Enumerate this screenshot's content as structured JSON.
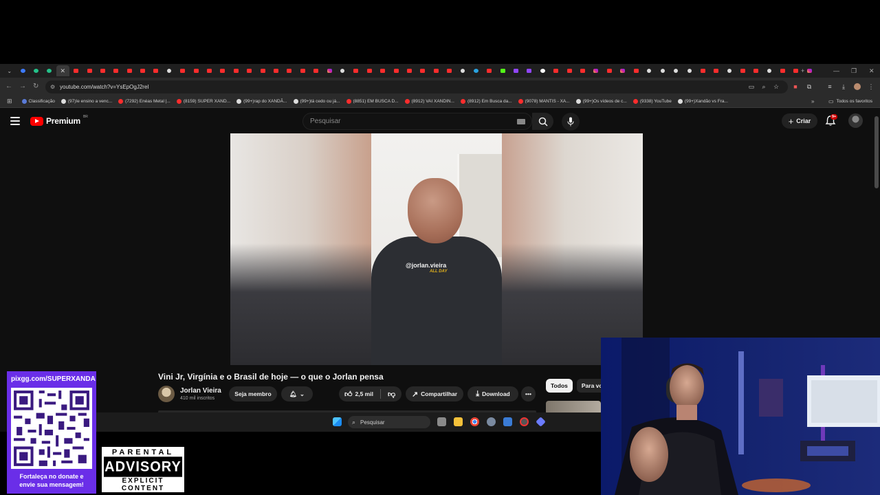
{
  "browser": {
    "url": "youtube.com/watch?v=YsEpOgJ2reI",
    "bookmarks": [
      {
        "label": "Classificação",
        "color": "#5a7bd8"
      },
      {
        "label": "(97)Ie ensino a venc...",
        "color": "#dddddd"
      },
      {
        "label": "(7292) Enéas Metal |...",
        "color": "#ff2d2d"
      },
      {
        "label": "(8159) SUPER XAND...",
        "color": "#ff2d2d"
      },
      {
        "label": "(99+)rap do XANDÃ...",
        "color": "#dddddd"
      },
      {
        "label": "(99+)tá cedo ou já...",
        "color": "#dddddd"
      },
      {
        "label": "(8851) EM BUSCA D...",
        "color": "#ff2d2d"
      },
      {
        "label": "(8912) VAI XANDIN...",
        "color": "#ff2d2d"
      },
      {
        "label": "(8912) Em Busca da...",
        "color": "#ff2d2d"
      },
      {
        "label": "(9078) MANTIS - XA...",
        "color": "#ff2d2d"
      },
      {
        "label": "(99+)Os vídeos de c...",
        "color": "#dddddd"
      },
      {
        "label": "(9338) YouTube",
        "color": "#ff2d2d"
      },
      {
        "label": "(99+)Xandão vs Fra...",
        "color": "#dddddd"
      }
    ],
    "all_bookmarks": "Todos os favoritos",
    "tab_favicons": [
      "blue",
      "green",
      "green",
      "active",
      "yt",
      "yt",
      "yt",
      "yt",
      "yt",
      "yt",
      "yt",
      "tt",
      "yt",
      "yt",
      "yt",
      "yt",
      "yt",
      "yt",
      "yt",
      "yt",
      "yt",
      "yt",
      "yt",
      "ig",
      "tt",
      "yt",
      "yt",
      "yt",
      "yt",
      "yt",
      "yt",
      "yt",
      "yt",
      "tt",
      "tg",
      "yt",
      "kick",
      "tw",
      "tw",
      "g",
      "yt",
      "yt",
      "yt",
      "ig",
      "yt",
      "ig",
      "yt",
      "tt",
      "tt",
      "tt",
      "tt",
      "yt",
      "yt",
      "tt",
      "yt",
      "yt",
      "tt",
      "yt",
      "yt",
      "ig"
    ]
  },
  "youtube": {
    "logo": "Premium",
    "country": "BR",
    "search_placeholder": "Pesquisar",
    "create": "Criar",
    "notifications": "9+",
    "video_watermark": "@jorlan.vieira",
    "video_watermark_sub": "ALL DAY",
    "title": "Vini Jr, Virgínia e o Brasil de hoje — o que o Jorlan pensa",
    "channel": "Jorlan Vieira",
    "subscribers": "410 mil inscritos",
    "join": "Seja membro",
    "likes": "2,5 mil",
    "share": "Compartilhar",
    "download": "Download",
    "chips": [
      "Todos",
      "Para vo"
    ]
  },
  "taskbar": {
    "search": "Pesquisar"
  },
  "overlay": {
    "donate_url": "pixgg.com/SUPERXANDA",
    "donate_msg_1": "Fortaleça no donate e",
    "donate_msg_2": "envie sua mensagem!",
    "pa_line1": "PARENTAL",
    "pa_line2": "ADVISORY",
    "pa_line3": "EXPLICIT CONTENT"
  }
}
